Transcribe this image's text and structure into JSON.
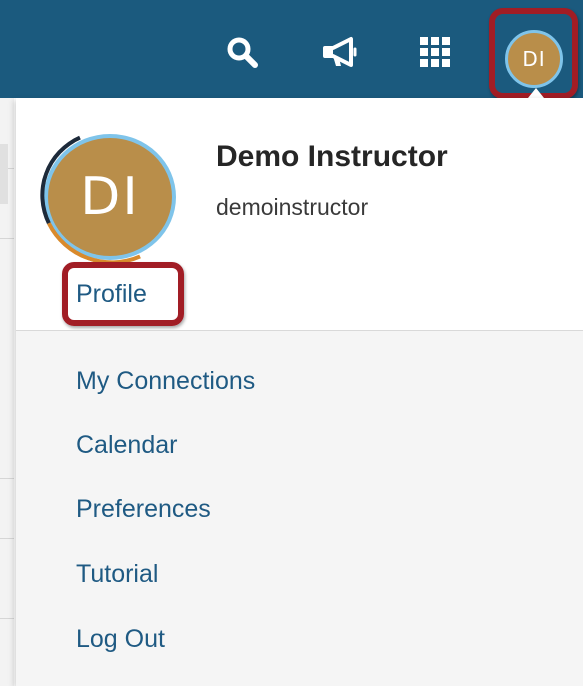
{
  "header": {
    "icons": [
      "search-icon",
      "megaphone-icon",
      "grid-apps-icon"
    ],
    "avatar_initials": "DI",
    "colors": {
      "bar": "#1b5a7e",
      "avatar": "#b98e4a",
      "avatar_ring": "#7fc4ea",
      "highlight": "#a11d25"
    }
  },
  "user": {
    "initials": "DI",
    "name": "Demo Instructor",
    "username": "demoinstructor",
    "profile_label": "Profile"
  },
  "menu": {
    "items": [
      {
        "label": "My Connections"
      },
      {
        "label": "Calendar"
      },
      {
        "label": "Preferences"
      },
      {
        "label": "Tutorial"
      },
      {
        "label": "Log Out"
      }
    ],
    "link_color": "#1f5a83"
  }
}
